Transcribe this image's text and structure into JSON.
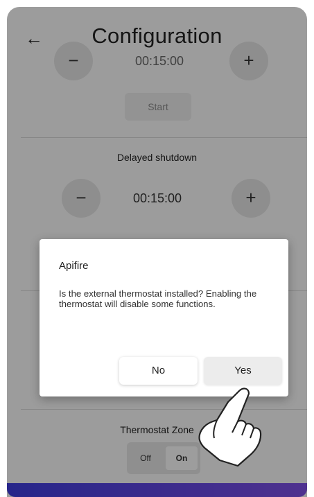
{
  "appbar": {
    "title": "Configuration",
    "back_icon": "←"
  },
  "timer_section_1": {
    "minus": "−",
    "plus": "+",
    "time": "00:15:00",
    "start_label": "Start"
  },
  "delayed_shutdown": {
    "title": "Delayed shutdown",
    "minus": "−",
    "plus": "+",
    "time": "00:15:00"
  },
  "thermostat": {
    "title": "Thermostat Zone",
    "off_label": "Off",
    "on_label": "On"
  },
  "dialog": {
    "title": "Apifire",
    "message": "Is the external thermostat installed? Enabling the thermostat will disable some functions.",
    "no_label": "No",
    "yes_label": "Yes"
  },
  "icons": {
    "back": "arrow-left-icon",
    "cursor": "hand-pointer-icon"
  },
  "colors": {
    "accent_start": "#3d3bd8",
    "accent_end": "#7c4de0"
  }
}
